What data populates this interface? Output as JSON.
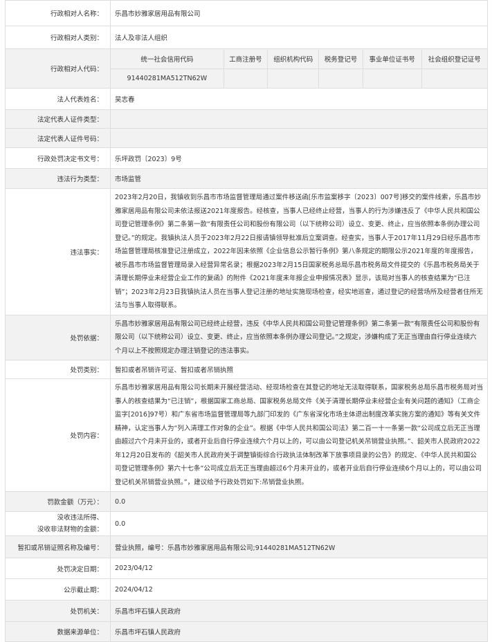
{
  "name": {
    "label": "行政相对人名称：",
    "value": "乐昌市妙雅家居用品有限公司"
  },
  "category": {
    "label": "行政相对人类别：",
    "value": "法人及非法人组织"
  },
  "code": {
    "label": "行政相对人代码：",
    "headers": [
      "统一社会信用代码",
      "工商注册号",
      "组织机构代码",
      "税务登记号",
      "事业单位证书号",
      "社会组织登记证号"
    ],
    "values": [
      "91440281MA512TN62W",
      "",
      "",
      "",
      "",
      ""
    ]
  },
  "legal_rep": {
    "label": "法人代表姓名：",
    "value": "吴志春"
  },
  "id_type": {
    "label": "法定代表人证件类型：",
    "value": ""
  },
  "id_number": {
    "label": "法定代表人证件号码：",
    "value": ""
  },
  "doc_no": {
    "label": "行政处罚决定书文号：",
    "value": "乐坪政罚〔2023〕9号"
  },
  "violation_type": {
    "label": "违法行为类型：",
    "value": "市场监管"
  },
  "facts": {
    "label": "违法事实：",
    "value": "2023年2月20日，我镇收到乐昌市市场监督管理局通过案件移送函[乐市监案移字〔2023〕007号]移交的案件线索，乐昌市妙雅家居用品有限公司未依法报送2021年度报告。经核查，当事人已经终止经营，当事人的行为涉嫌违反了《中华人民共和国公司登记管理条例》第二条第一款“有限责任公司和股份有限公司（以下统称公司）设立、变更、终止，应当依照本条例办理公司登记。”的规定。我镇执法人员于2023年2月22日报请镇领导批准后立案调查。经查实，当事人于2017年11月29日经乐昌市市场监督管理局核准登记注册成立，2022年因未依照《企业信息公示暂行条例》第八条规定的期限公示2021年度的年度报告，被乐昌市市场监督管理局录入经营异常名录；根据2023年2月15日国家税务总局乐昌市税务局文件提交的《乐昌市税务局关于清理长期停业未经营企业工作的复函》的附件《2021年度未年报企业申报情况表》显示，该局对当事人的核查结果为“已注销”；2023年2月23日我镇执法人员在当事人登记注册的地址实施现场检查，经实地巡查，通过登记的经营场所及经营者住所无法与当事人取得联系。"
  },
  "basis": {
    "label": "处罚依据：",
    "value": "乐昌市妙雅家居用品有限公司已经终止经营，违反《中华人民共和国公司登记管理条例》第二条第一款“有限责任公司和股份有限公司（以下统称公司）设立、变更、终止，应当依照本条例办理公司登记。”之规定，涉嫌构成了无正当理由自行停业连续六个月以上不按照规定办理注销登记的违法事实。"
  },
  "penalty_type": {
    "label": "处罚类别：",
    "value": "暂扣或者吊销许可证、暂扣或者吊销执照"
  },
  "content": {
    "label": "处罚内容：",
    "value": "乐昌市妙雅家居用品有限公司长期未开展经营活动、经现场检查在其登记的地址无法取得联系，国家税务总局乐昌市税务局对当事人的核查结果为“已注销”，根据国家工商总局、国家税务总局文件《关于清理长期停业未经营企业有关问题的通知》（工商企监字[2016]97号）和广东省市场监督管理局等九部门印发的《广东省深化市场主体退出制度改革实施方案的通知》等有关文件精神，认定当事人为“列入清理工作对象的企业”。根据《中华人民共和国公司法》第二百一十一条第一款“公司成立后无正当理由超过六个月未开业的，或者开业后自行停业连续六个月以上的，可以由公司登记机关吊销营业执照。”、韶关市人民政府2022年12月20日发布的《韶关市人民政府关于调整镇街综合行政执法体制改革下放事项目录的公告》的规定、《中华人民共和国公司登记管理条例》第六十七条“公司成立后无正当理由超过6个月未开业的，或者开业后自行停业连续6个月以上的，可以由公司登记机关吊销营业执照。”，建议给予行政处罚如下:吊销营业执照。"
  },
  "fine": {
    "label": "罚款金额（万元）：",
    "value": "0.0"
  },
  "confiscation": {
    "label1": "没收违法所得、",
    "label2": "没收非法财物的金额：",
    "value": "0.0"
  },
  "license": {
    "label": "暂扣或吊销证照名称及编号：",
    "value": "营业执照，编号：乐昌市妙雅家居用品有限公司;91440281MA512TN62W"
  },
  "decision_date": {
    "label": "处罚决定日期：",
    "value": "2023/04/12"
  },
  "publicity_end": {
    "label": "公示截止期：",
    "value": "2024/04/12"
  },
  "authority": {
    "label": "处罚机关：",
    "value": "乐昌市坪石镇人民政府"
  },
  "source": {
    "label": "数据来源单位：",
    "value": "乐昌市坪石镇人民政府"
  }
}
